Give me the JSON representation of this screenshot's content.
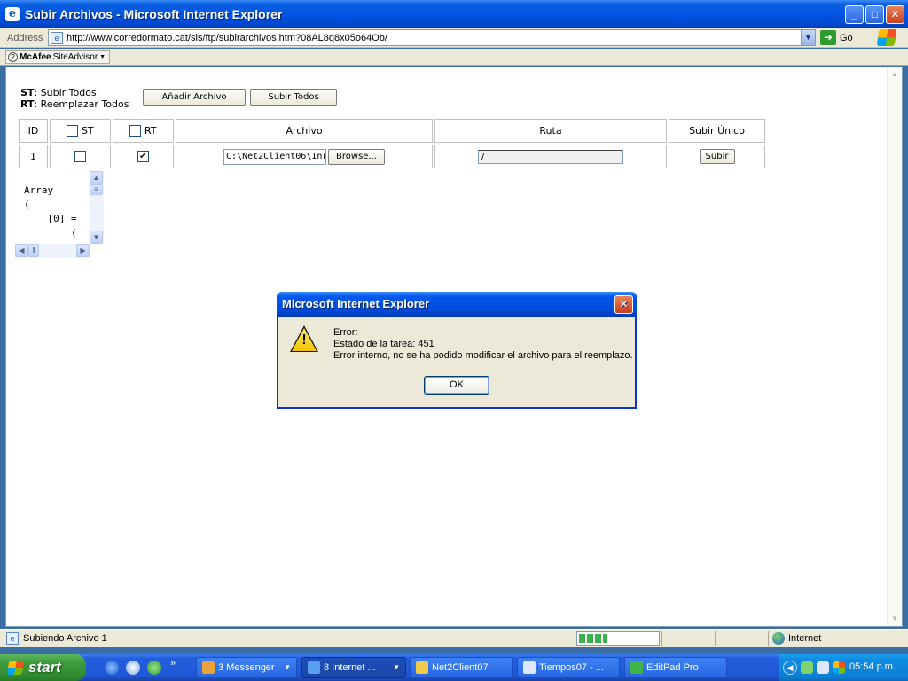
{
  "window": {
    "title": "Subir Archivos - Microsoft Internet Explorer",
    "buttons": {
      "minimize": "_",
      "maximize": "□",
      "close": "✕"
    }
  },
  "address_bar": {
    "label": "Address",
    "url": "http://www.corredormato.cat/sis/ftp/subirarchivos.htm?08AL8q8x05o64Ob/",
    "go_label": "Go"
  },
  "toolbar": {
    "mcafee_brand": "McAfee",
    "mcafee_product": "SiteAdvisor"
  },
  "page": {
    "legend": [
      {
        "key": "ST",
        "text": ": Subir Todos"
      },
      {
        "key": "RT",
        "text": ": Reemplazar Todos"
      }
    ],
    "buttons": {
      "add_file": "Añadir Archivo",
      "upload_all": "Subir Todos"
    },
    "table": {
      "headers": {
        "id": "ID",
        "st": "ST",
        "rt": "RT",
        "file": "Archivo",
        "path": "Ruta",
        "single": "Subir Único"
      },
      "rows": [
        {
          "id": "1",
          "st_checked": false,
          "rt_checked": true,
          "file_value": "C:\\Net2Client06\\Inr",
          "browse_label": "Browse...",
          "path_value": "/",
          "upload_label": "Subir"
        }
      ]
    },
    "debug_output": "Array\n(\n    [0] =\n        ("
  },
  "dialog": {
    "title": "Microsoft Internet Explorer",
    "close": "✕",
    "icon": "warning-icon",
    "lines": [
      "Error:",
      "Estado de la tarea: 451",
      "Error interno, no se ha podido modificar el archivo para el reemplazo."
    ],
    "ok_label": "OK"
  },
  "status_bar": {
    "text": "Subiendo Archivo 1",
    "progress": 0.35,
    "zone": "Internet"
  },
  "taskbar": {
    "start_label": "start",
    "tasks": [
      {
        "label": "3 Messenger",
        "active": false,
        "color": "#e8a33a"
      },
      {
        "label": "8 Internet ...",
        "active": true,
        "color": "#5aa0f0"
      },
      {
        "label": "Net2Client07",
        "active": false,
        "color": "#f0c84a"
      },
      {
        "label": "Tiempos07 - ...",
        "active": false,
        "color": "#dfe8f8"
      },
      {
        "label": "EditPad Pro",
        "active": false,
        "color": "#3fb34a"
      }
    ],
    "clock": "05:54 p.m."
  },
  "colors": {
    "xp_blue": "#0054e3",
    "dialog_border": "#0831d9",
    "progress_green": "#37b34a",
    "start_green": "#3c9c3c"
  }
}
